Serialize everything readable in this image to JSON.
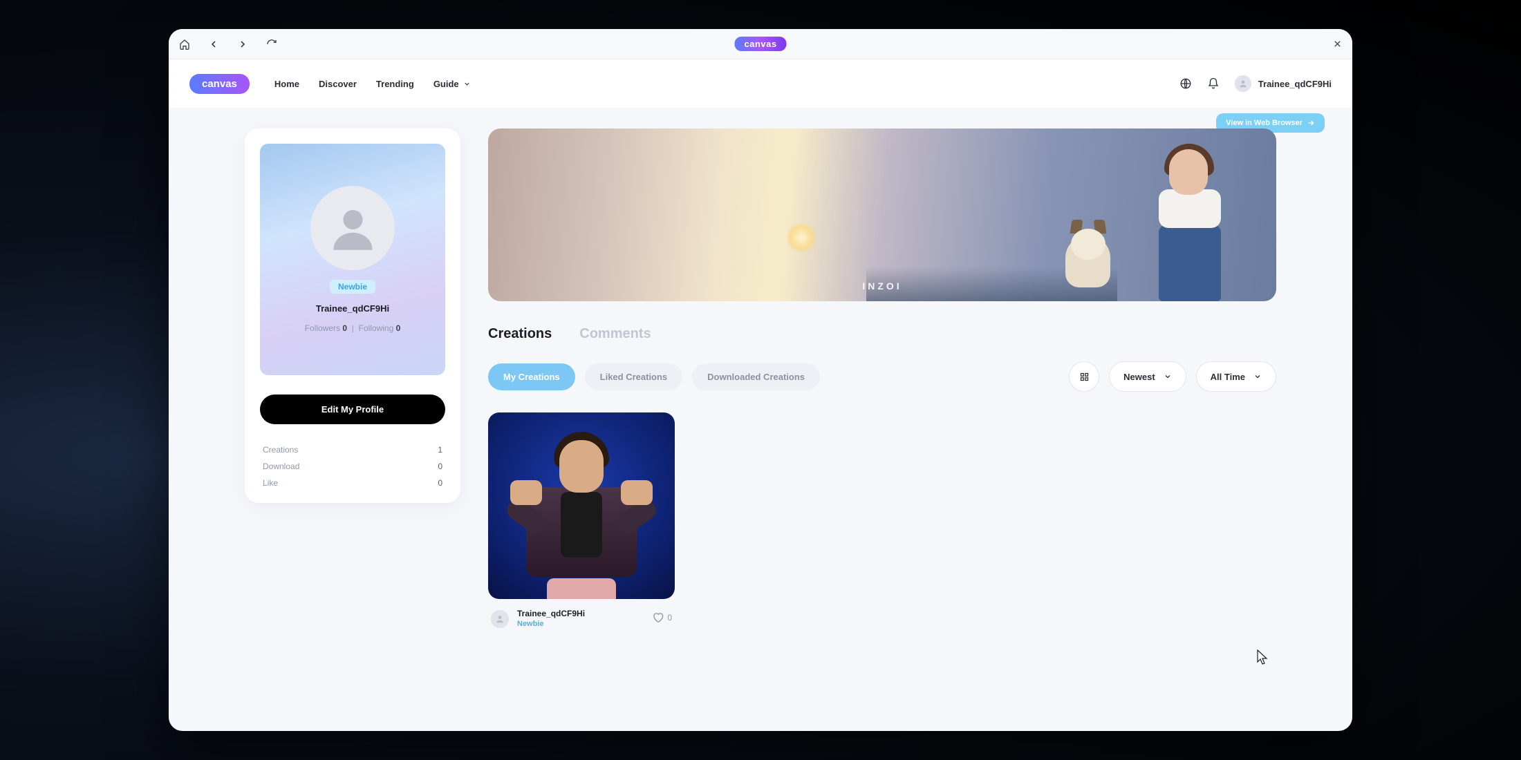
{
  "titlebar": {
    "logo": "canvas"
  },
  "nav": {
    "logo": "canvas",
    "links": {
      "home": "Home",
      "discover": "Discover",
      "trending": "Trending",
      "guide": "Guide"
    },
    "username": "Trainee_qdCF9Hi"
  },
  "viewBrowser": "View in Web Browser",
  "profile": {
    "badge": "Newbie",
    "username": "Trainee_qdCF9Hi",
    "followersLabel": "Followers",
    "followersCount": "0",
    "followingLabel": "Following",
    "followingCount": "0",
    "editBtn": "Edit My Profile",
    "stats": {
      "creationsLabel": "Creations",
      "creationsVal": "1",
      "downloadLabel": "Download",
      "downloadVal": "0",
      "likeLabel": "Like",
      "likeVal": "0"
    }
  },
  "banner": {
    "logoText": "INZOI"
  },
  "tabs": {
    "creations": "Creations",
    "comments": "Comments"
  },
  "filters": {
    "pills": {
      "my": "My Creations",
      "liked": "Liked Creations",
      "downloaded": "Downloaded Creations"
    },
    "sort": "Newest",
    "time": "All Time"
  },
  "creations": [
    {
      "author": "Trainee_qdCF9Hi",
      "badge": "Newbie",
      "likes": "0"
    }
  ]
}
